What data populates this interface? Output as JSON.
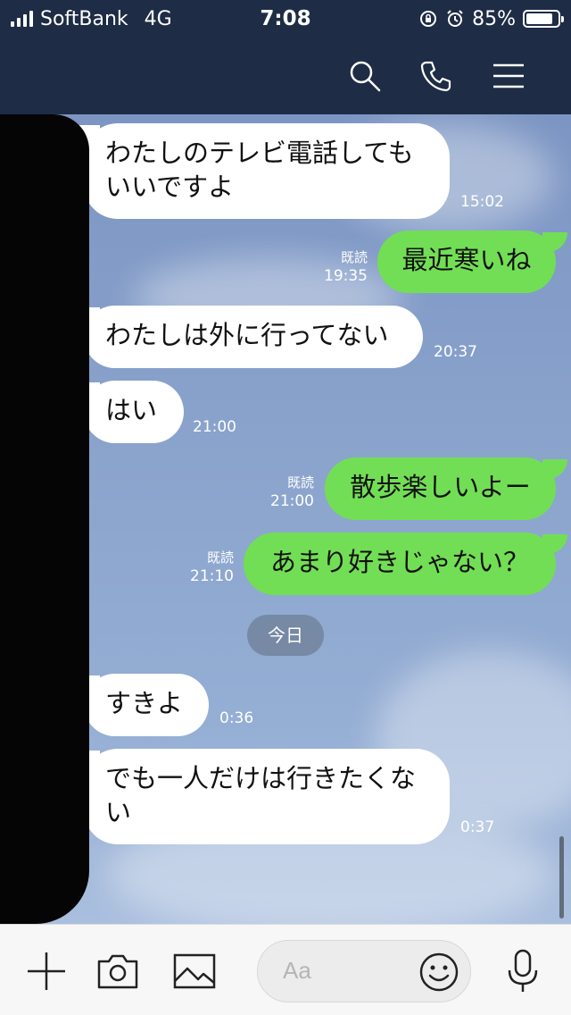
{
  "status_bar": {
    "carrier": "SoftBank",
    "network": "4G",
    "time": "7:08",
    "battery": "85%",
    "battery_level": 0.85
  },
  "messages": [
    {
      "side": "in",
      "text_lines": [
        "わたしのテレビ電話しても",
        "いいですよ"
      ],
      "time": "15:02"
    },
    {
      "side": "out",
      "text": "最近寒いね",
      "read": "既読",
      "time": "19:35"
    },
    {
      "side": "in",
      "text": "わたしは外に行ってない",
      "time": "20:37"
    },
    {
      "side": "in",
      "text": "はい",
      "time": "21:00"
    },
    {
      "side": "out",
      "text": "散歩楽しいよー",
      "read": "既読",
      "time": "21:00"
    },
    {
      "side": "out",
      "text": "あまり好きじゃない？",
      "read": "既読",
      "time": "21:10"
    },
    {
      "side": "in",
      "text": "すきよ",
      "time": "0:36"
    },
    {
      "side": "in",
      "text_lines": [
        "でも一人だけは行きたくな",
        "い"
      ],
      "time": "0:37"
    }
  ],
  "date_separator": "今日",
  "input": {
    "placeholder": "Aa"
  },
  "colors": {
    "header": "#1e2c45",
    "outgoing_bubble": "#72de55",
    "incoming_bubble": "#ffffff"
  }
}
